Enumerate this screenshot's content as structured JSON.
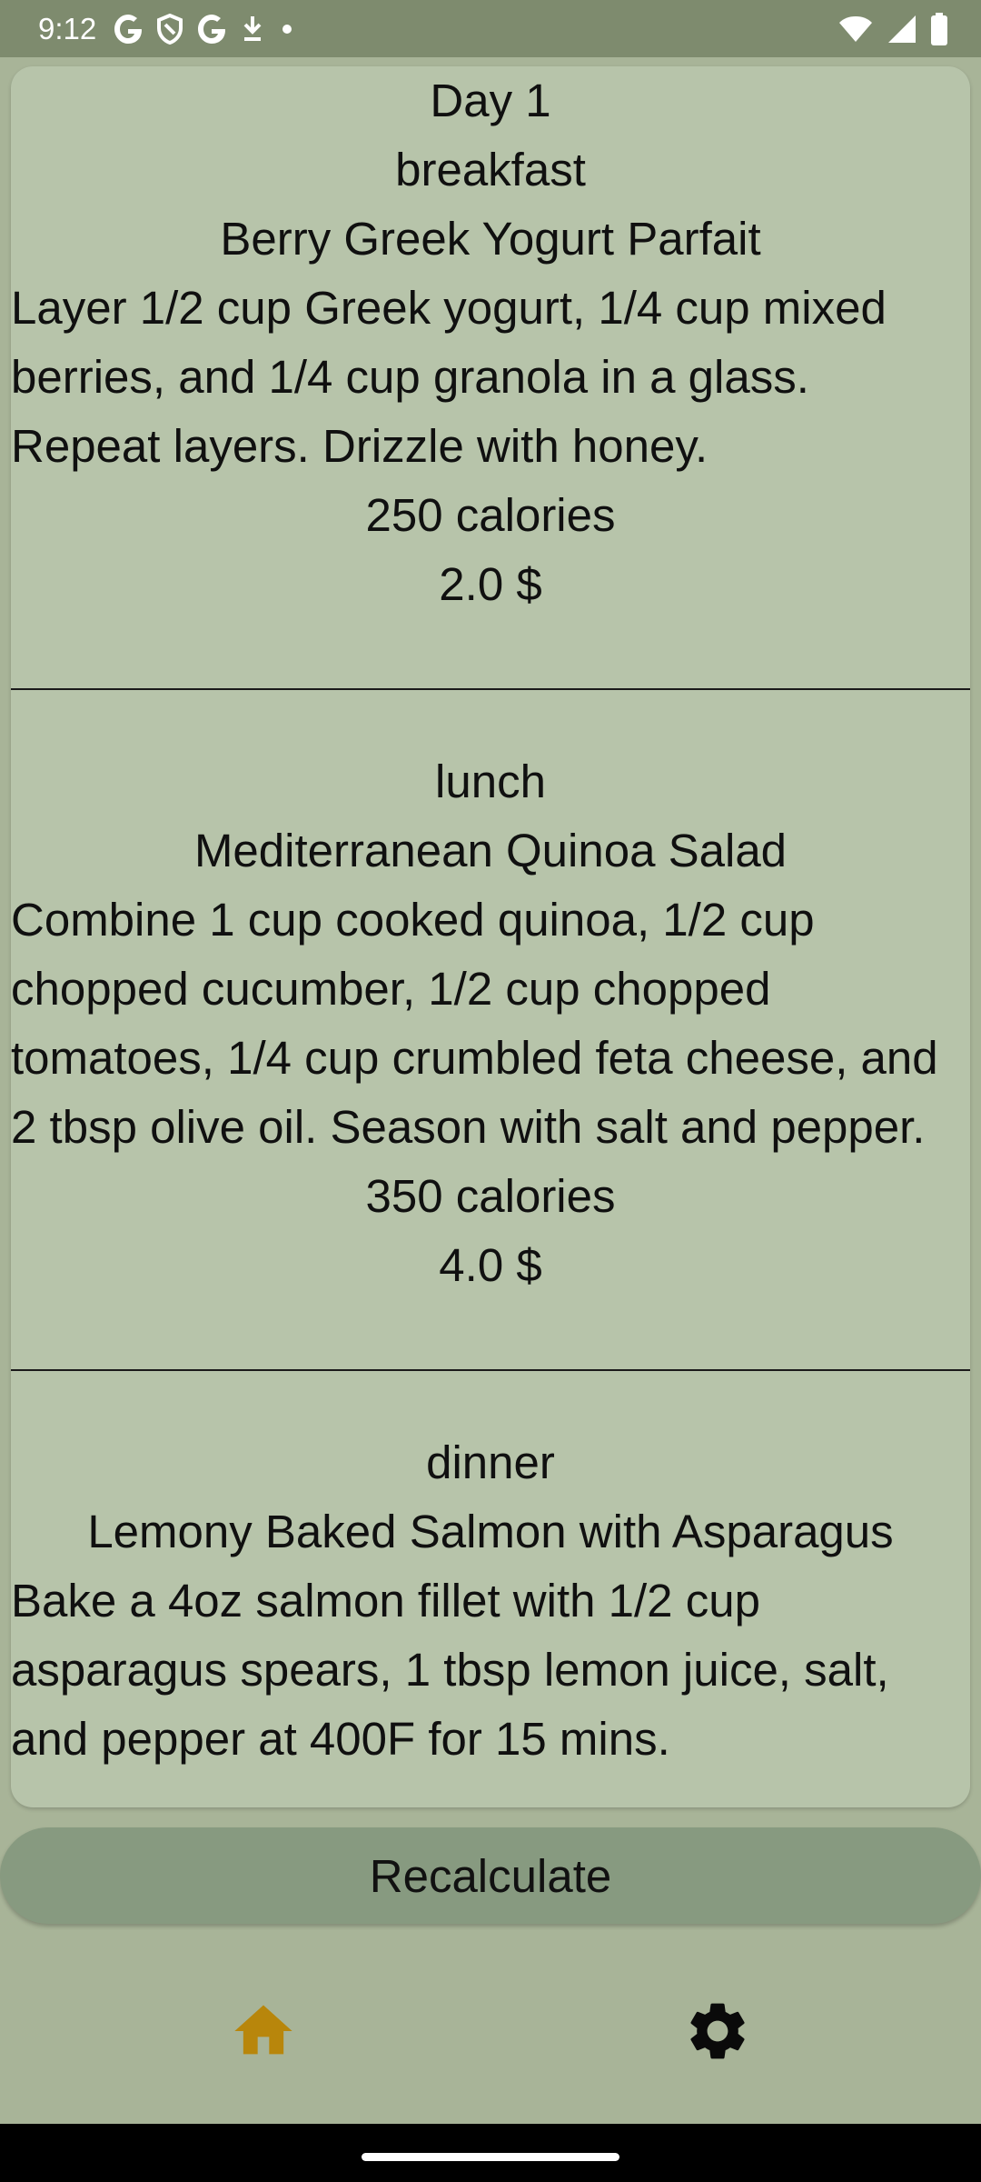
{
  "status_bar": {
    "time": "9:12",
    "left_icons": [
      "google-icon",
      "shield-icon",
      "google-icon",
      "download-icon",
      "dot-icon"
    ],
    "right_icons": [
      "wifi-icon",
      "signal-icon",
      "battery-icon"
    ]
  },
  "plan": {
    "day_title": "Day 1",
    "meals": [
      {
        "type": "breakfast",
        "name": "Berry Greek Yogurt Parfait",
        "instructions": "Layer 1/2 cup Greek yogurt, 1/4 cup mixed berries, and 1/4 cup granola in a glass. Repeat layers. Drizzle with honey.",
        "calories": "250 calories",
        "cost": "2.0 $"
      },
      {
        "type": "lunch",
        "name": "Mediterranean Quinoa Salad",
        "instructions": "Combine 1 cup cooked quinoa, 1/2 cup chopped cucumber, 1/2 cup chopped tomatoes, 1/4 cup crumbled feta cheese, and 2 tbsp olive oil. Season with salt and pepper.",
        "calories": "350 calories",
        "cost": "4.0 $"
      },
      {
        "type": "dinner",
        "name": "Lemony Baked Salmon with Asparagus",
        "instructions": "Bake a 4oz salmon fillet with 1/2 cup asparagus spears, 1 tbsp lemon juice, salt, and pepper at 400F for 15 mins."
      }
    ]
  },
  "actions": {
    "recalculate_label": "Recalculate"
  },
  "bottom_nav": {
    "items": [
      {
        "icon": "home-icon",
        "active": true,
        "color": "#b8860b"
      },
      {
        "icon": "gear-icon",
        "active": false,
        "color": "#0a0a0a"
      }
    ]
  }
}
